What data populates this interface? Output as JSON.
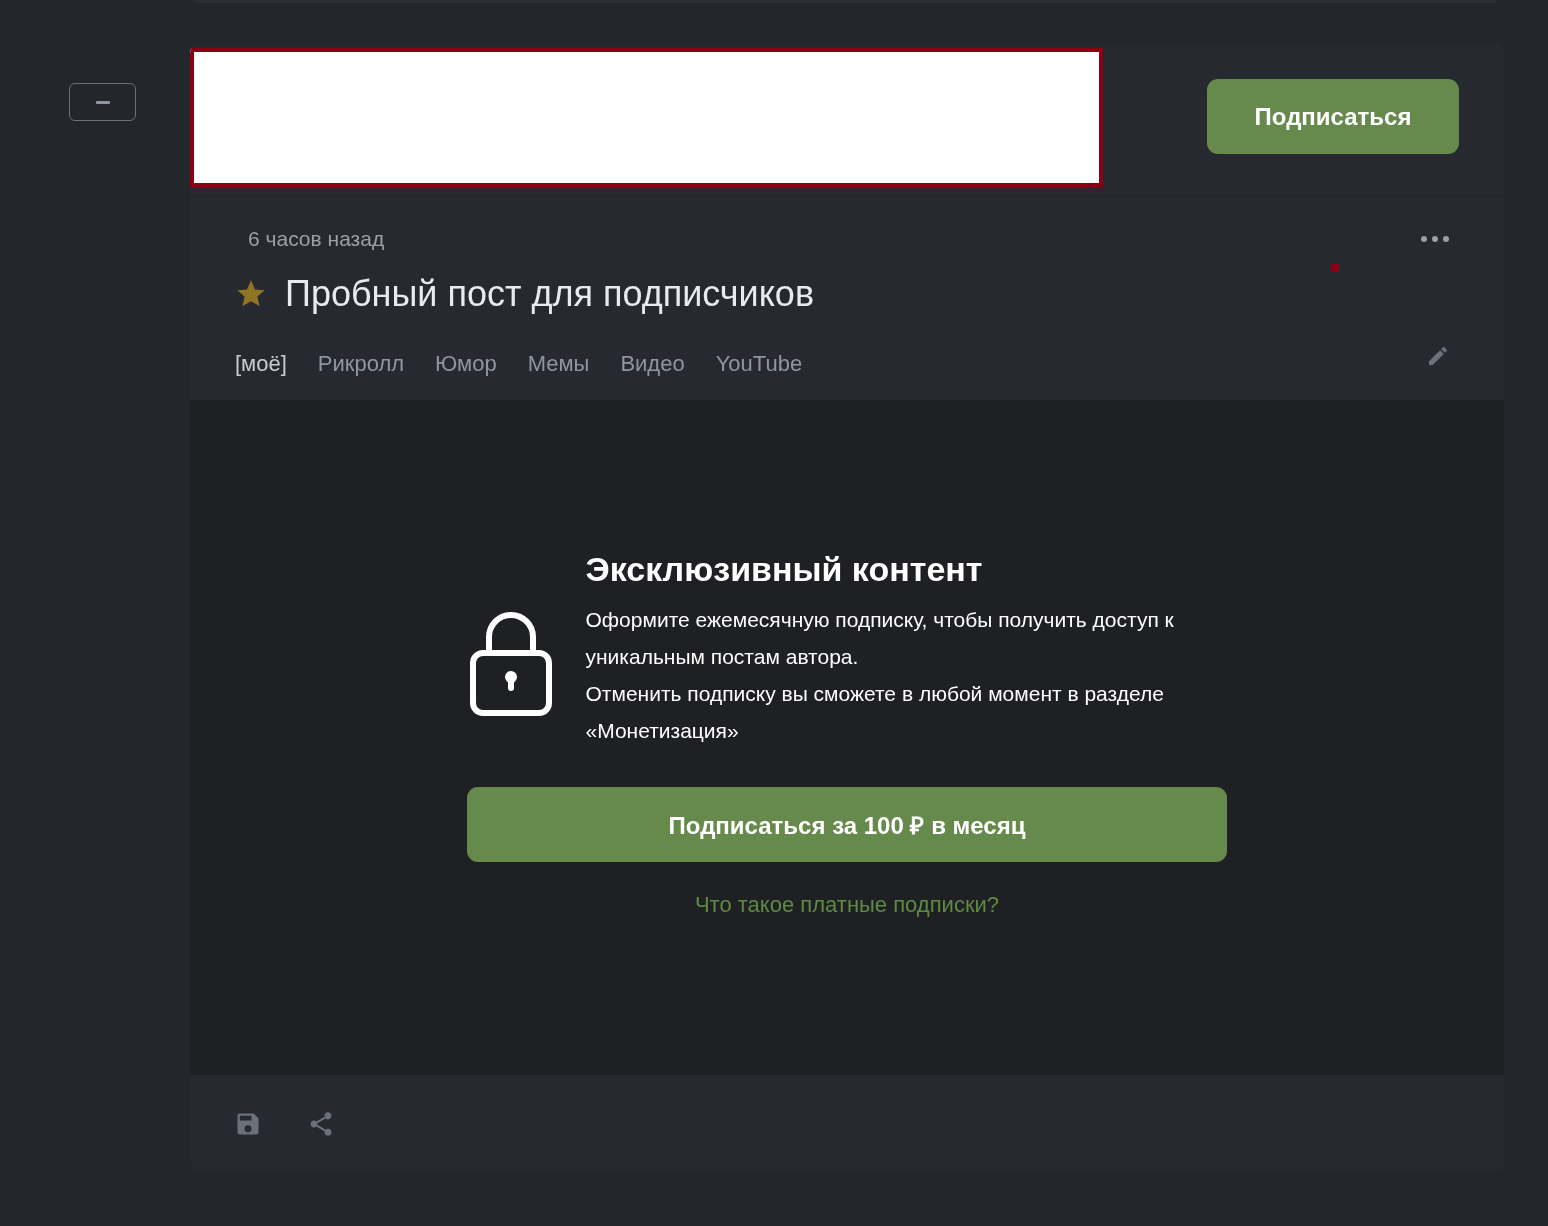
{
  "header": {
    "subscribe_button": "Подписаться"
  },
  "post": {
    "time": "6 часов назад",
    "starred": true,
    "title": "Пробный пост для подписчиков",
    "tags": [
      {
        "label": "[моё]",
        "highlighted": true
      },
      {
        "label": "Рикролл",
        "highlighted": false
      },
      {
        "label": "Юмор",
        "highlighted": false
      },
      {
        "label": "Мемы",
        "highlighted": false
      },
      {
        "label": "Видео",
        "highlighted": false
      },
      {
        "label": "YouTube",
        "highlighted": false
      }
    ]
  },
  "paywall": {
    "title": "Эксклюзивный контент",
    "paragraphs": [
      "Оформите ежемесячную подписку, чтобы получить доступ к уникальным постам автора.",
      "Отменить подписку вы сможете в любой момент в разделе «Монетизация»"
    ],
    "button": "Подписаться за 100 ₽ в месяц",
    "link": "Что такое платные подписки?"
  }
}
